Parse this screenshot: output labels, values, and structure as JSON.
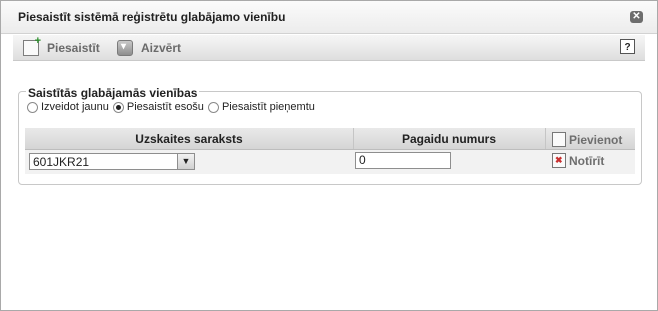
{
  "dialog": {
    "title": "Piesaistīt sistēmā reģistrētu glabājamo vienību",
    "close_icon": "close-icon"
  },
  "toolbar": {
    "attach_label": "Piesaistīt",
    "close_label": "Aizvērt",
    "help_label": "?"
  },
  "section": {
    "legend": "Saistītās glabājamās vienības",
    "radios": [
      {
        "label": "Izveidot jaunu",
        "checked": false
      },
      {
        "label": "Piesaistīt esošu",
        "checked": true
      },
      {
        "label": "Piesaistīt pieņemtu",
        "checked": false
      }
    ]
  },
  "grid": {
    "headers": [
      "Uzskaites saraksts",
      "Pagaidu numurs"
    ],
    "add_label": "Pievienot",
    "row": {
      "list_value": "601JKR21",
      "temp_number": "0",
      "clear_label": "Notīrīt"
    }
  }
}
